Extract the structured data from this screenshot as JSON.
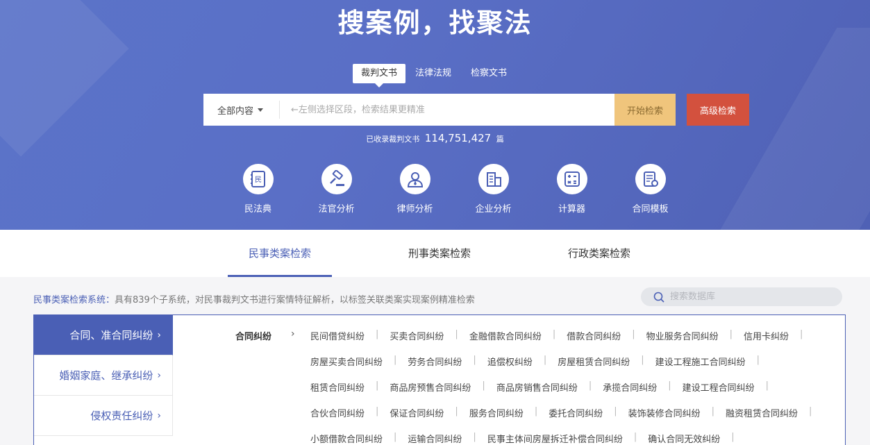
{
  "hero": {
    "title": "搜案例，找聚法",
    "search_tabs": [
      "裁判文书",
      "法律法规",
      "检察文书"
    ],
    "scope_label": "全部内容",
    "search_placeholder": "←左侧选择区段，检索结果更精准",
    "search_button": "开始检索",
    "advanced_button": "高级检索",
    "count_prefix": "已收录裁判文书",
    "count_value": "114,751,427",
    "count_unit": "篇",
    "tools": [
      {
        "label": "民法典",
        "icon": "civil-code-icon"
      },
      {
        "label": "法官分析",
        "icon": "gavel-icon"
      },
      {
        "label": "律师分析",
        "icon": "lawyer-icon"
      },
      {
        "label": "企业分析",
        "icon": "building-icon"
      },
      {
        "label": "计算器",
        "icon": "calculator-icon"
      },
      {
        "label": "合同模板",
        "icon": "contract-icon"
      }
    ]
  },
  "case_tabs": [
    "民事类案检索",
    "刑事类案检索",
    "行政类案检索"
  ],
  "description": {
    "title": "民事类案检索系统：",
    "text": "具有839个子系统，对民事裁判文书进行案情特征解析，以标签关联类案实现案例精准检索"
  },
  "db_search_placeholder": "搜索数据库",
  "categories": [
    "合同、准合同纠纷",
    "婚姻家庭、继承纠纷",
    "侵权责任纠纷"
  ],
  "sub_heading": "合同纠纷",
  "sub_rows": [
    [
      "民间借贷纠纷",
      "买卖合同纠纷",
      "金融借款合同纠纷",
      "借款合同纠纷",
      "物业服务合同纠纷",
      "信用卡纠纷"
    ],
    [
      "房屋买卖合同纠纷",
      "劳务合同纠纷",
      "追偿权纠纷",
      "房屋租赁合同纠纷",
      "建设工程施工合同纠纷"
    ],
    [
      "租赁合同纠纷",
      "商品房预售合同纠纷",
      "商品房销售合同纠纷",
      "承揽合同纠纷",
      "建设工程合同纠纷"
    ],
    [
      "合伙合同纠纷",
      "保证合同纠纷",
      "服务合同纠纷",
      "委托合同纠纷",
      "装饰装修合同纠纷",
      "融资租赁合同纠纷"
    ],
    [
      "小额借款合同纠纷",
      "运输合同纠纷",
      "民事主体间房屋拆迁补偿合同纠纷",
      "确认合同无效纠纷"
    ]
  ],
  "colors": {
    "brand": "#4a5fb5",
    "search_button": "#f0c57c",
    "advanced_button": "#d3513e"
  }
}
